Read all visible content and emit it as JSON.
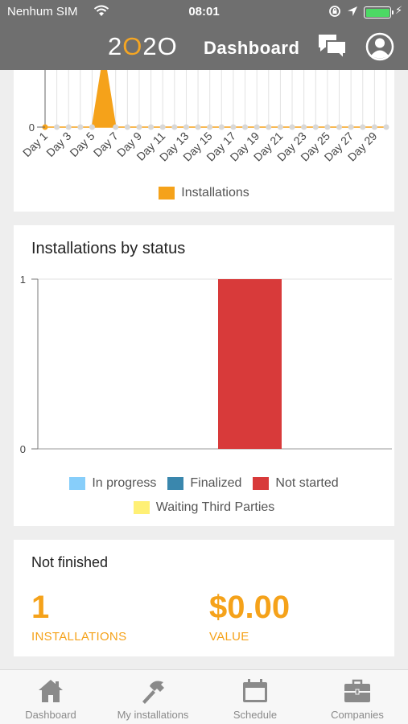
{
  "status_bar": {
    "carrier": "Nenhum SIM",
    "time": "08:01"
  },
  "header": {
    "logo_text": "2020",
    "title": "Dashboard"
  },
  "colors": {
    "header_bg": "#6f6f6f",
    "accent": "#f5a21a",
    "not_started": "#d83a3a",
    "in_progress": "#87cefa",
    "finalized": "#3a87ad",
    "waiting": "#fff075"
  },
  "chart_data": [
    {
      "type": "area",
      "categories": [
        "Day 1",
        "Day 3",
        "Day 5",
        "Day 7",
        "Day 9",
        "Day 11",
        "Day 13",
        "Day 15",
        "Day 17",
        "Day 19",
        "Day 21",
        "Day 23",
        "Day 25",
        "Day 27",
        "Day 29"
      ],
      "x": [
        1,
        2,
        3,
        4,
        5,
        6,
        7,
        8,
        9,
        10,
        11,
        12,
        13,
        14,
        15,
        16,
        17,
        18,
        19,
        20,
        21,
        22,
        23,
        24,
        25,
        26,
        27,
        28,
        29,
        30
      ],
      "series": [
        {
          "name": "Installations",
          "values": [
            0,
            0,
            0,
            0,
            0,
            1,
            0,
            0,
            0,
            0,
            0,
            0,
            0,
            0,
            0,
            0,
            0,
            0,
            0,
            0,
            0,
            0,
            0,
            0,
            0,
            0,
            0,
            0,
            0,
            0
          ]
        }
      ],
      "y_tick_visible": "0",
      "grid": true,
      "legend": "bottom"
    },
    {
      "type": "bar",
      "title": "Installations by status",
      "categories": [
        "In progress",
        "Finalized",
        "Not started",
        "Waiting Third Parties"
      ],
      "series": [
        {
          "name": "In progress",
          "values": [
            0
          ]
        },
        {
          "name": "Finalized",
          "values": [
            0
          ]
        },
        {
          "name": "Not started",
          "values": [
            1
          ]
        },
        {
          "name": "Waiting Third Parties",
          "values": [
            0
          ]
        }
      ],
      "y_ticks": [
        "0",
        "1"
      ],
      "ylim": [
        0,
        1
      ],
      "legend": "bottom"
    }
  ],
  "not_finished": {
    "title": "Not finished",
    "installations_value": "1",
    "installations_label": "INSTALLATIONS",
    "value_value": "$0.00",
    "value_label": "VALUE"
  },
  "tabs": [
    {
      "label": "Dashboard",
      "icon": "house-icon"
    },
    {
      "label": "My installations",
      "icon": "hammer-icon"
    },
    {
      "label": "Schedule",
      "icon": "calendar-icon"
    },
    {
      "label": "Companies",
      "icon": "briefcase-icon"
    }
  ]
}
